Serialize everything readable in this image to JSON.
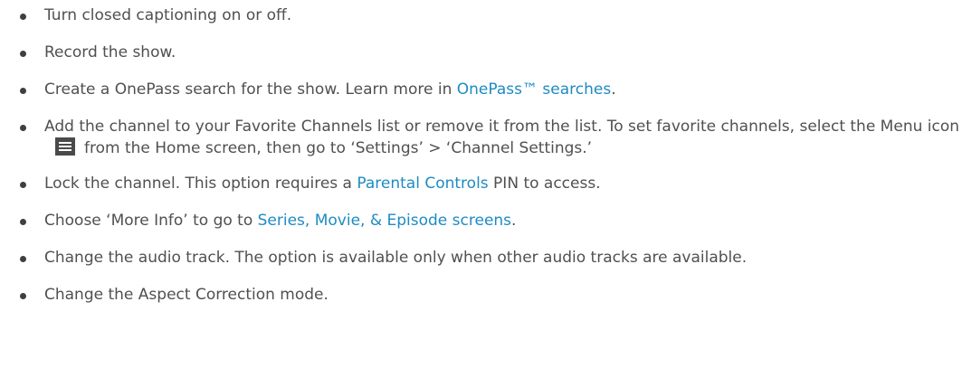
{
  "items": [
    {
      "text": "Turn closed captioning on or off."
    },
    {
      "text": "Record the show."
    },
    {
      "before": "Create a OnePass search for the show. Learn more in ",
      "link": "OnePass™ searches",
      "after": "."
    },
    {
      "before": "Add the channel to your Favorite Channels list or remove it from the list. To set favorite channels, select the Menu icon",
      "icon": "menu-icon",
      "after": "from the Home screen, then go to ‘Settings’ > ‘Channel Settings.’"
    },
    {
      "before": "Lock the channel. This option requires a ",
      "link": "Parental Controls",
      "after": " PIN to access."
    },
    {
      "before": "Choose ‘More Info’ to go to ",
      "link": "Series, Movie, & Episode screens",
      "after": "."
    },
    {
      "text": "Change the audio track. The option is available only when other audio tracks are available."
    },
    {
      "text": "Change the Aspect Correction mode."
    }
  ],
  "colors": {
    "text": "#505050",
    "link": "#1e8bc3",
    "bullet": "#3f3f3f",
    "icon_bg": "#4a4a4a"
  }
}
